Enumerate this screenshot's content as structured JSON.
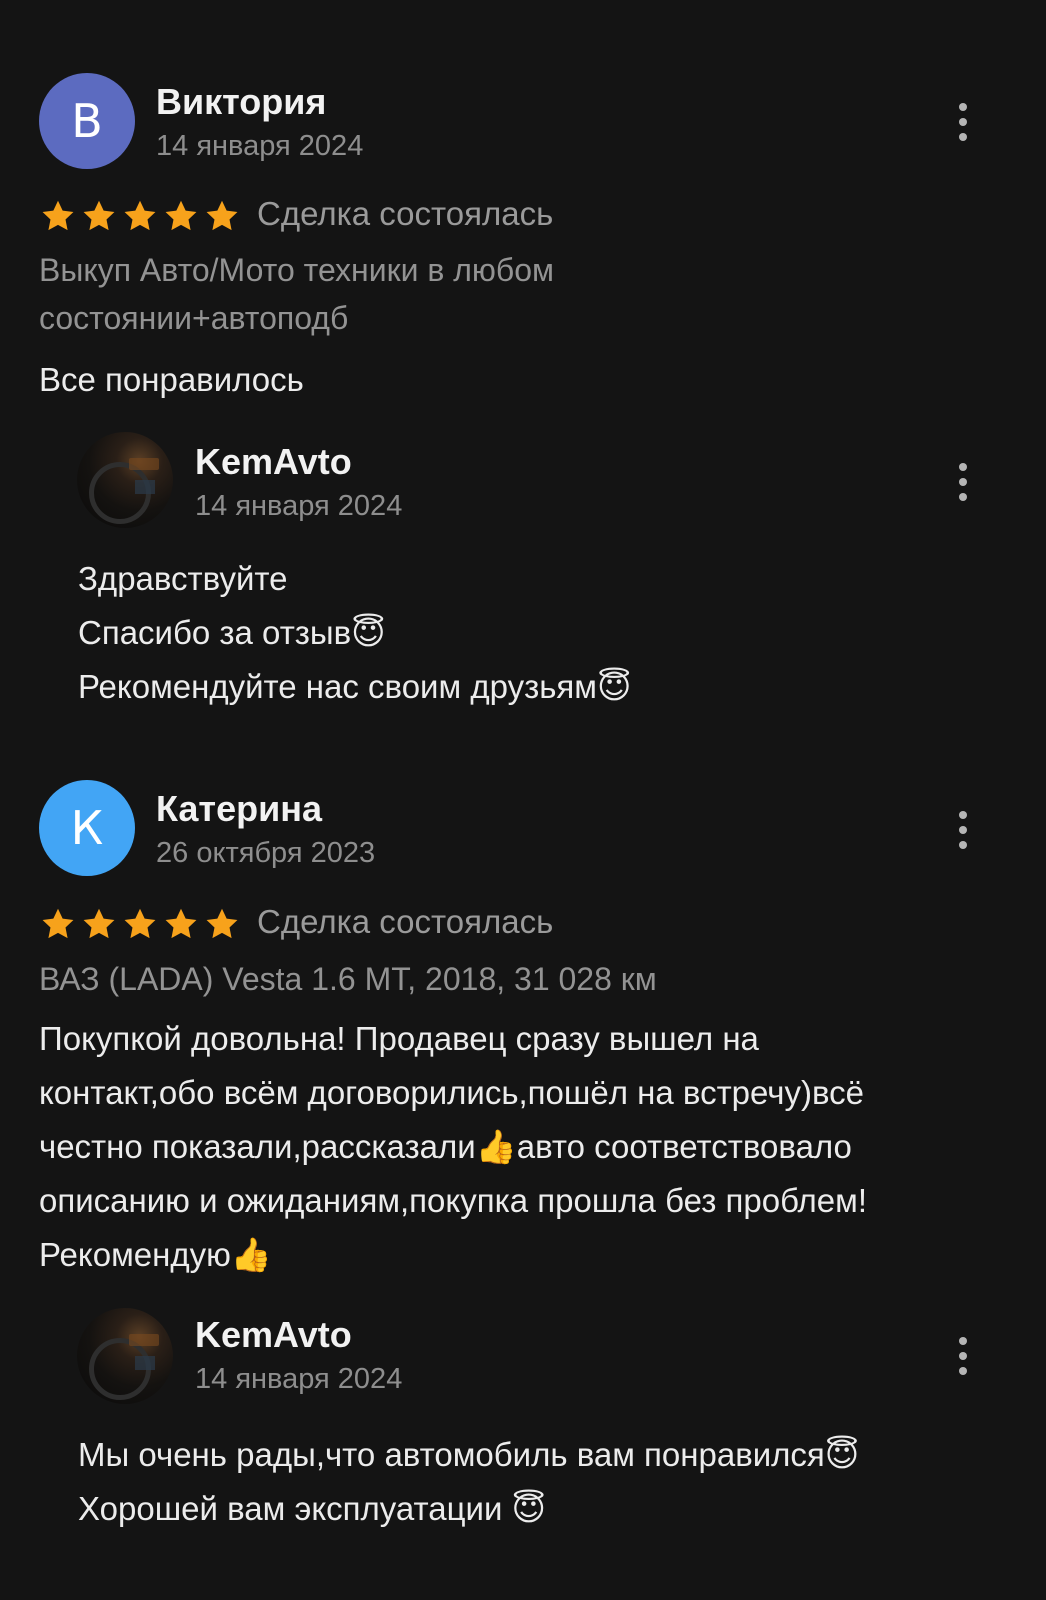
{
  "colors": {
    "background": "#141414",
    "star": "#f7a21b",
    "avatar_v": "#5c6bc0",
    "avatar_k": "#42a5f5"
  },
  "icons": {
    "more": "more-vertical-icon",
    "star": "star-icon"
  },
  "reviews": [
    {
      "author_initial": "В",
      "author_name": "Виктория",
      "date": "14 января 2024",
      "rating": 5,
      "status": "Сделка состоялась",
      "subject_line1": "Выкуп Авто/Мото техники в любом",
      "subject_line2": "состоянии+автоподб",
      "text": "Все понравилось",
      "reply": {
        "author_name": "KemAvto",
        "date": "14 января 2024",
        "line1": "Здравствуйте",
        "line2": "Спасибо за отзыв😇",
        "line3": "Рекомендуйте нас своим друзьям😇"
      }
    },
    {
      "author_initial": "К",
      "author_name": "Катерина",
      "date": "26 октября 2023",
      "rating": 5,
      "status": "Сделка состоялась",
      "subject_line1": "ВАЗ (LADA) Vesta 1.6 MT, 2018, 31 028 км",
      "text_line1": "Покупкой довольна! Продавец сразу вышел на",
      "text_line2": "контакт,обо всём договорились,пошёл на встречу)всё",
      "text_line3": "честно показали,рассказали👍авто соответствовало",
      "text_line4": "описанию и ожиданиям,покупка прошла без проблем!",
      "text_line5": "Рекомендую👍",
      "reply": {
        "author_name": "KemAvto",
        "date": "14 января 2024",
        "line1": "Мы очень рады,что автомобиль вам понравился😇",
        "line2": "Хорошей вам эксплуатации 😇"
      }
    }
  ]
}
